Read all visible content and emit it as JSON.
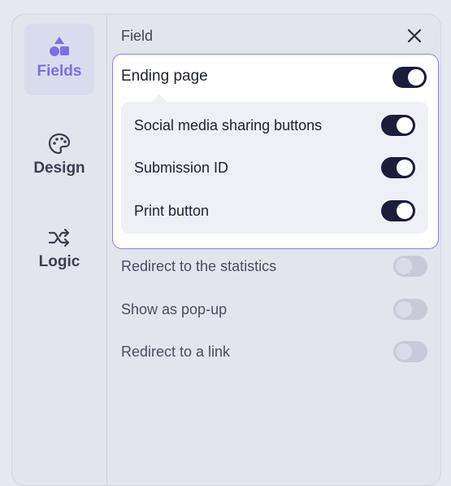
{
  "sidebar": {
    "items": [
      {
        "label": "Fields",
        "icon": "shapes-icon",
        "active": true
      },
      {
        "label": "Design",
        "icon": "palette-icon",
        "active": false
      },
      {
        "label": "Logic",
        "icon": "shuffle-icon",
        "active": false
      }
    ]
  },
  "header": {
    "title": "Field",
    "close_icon": "close-icon"
  },
  "ending_page": {
    "label": "Ending page",
    "enabled": true,
    "sub_options": [
      {
        "label": "Social media sharing buttons",
        "enabled": true
      },
      {
        "label": "Submission ID",
        "enabled": true
      },
      {
        "label": "Print button",
        "enabled": true
      }
    ]
  },
  "options": [
    {
      "label": "Redirect to the statistics",
      "enabled": false
    },
    {
      "label": "Show as pop-up",
      "enabled": false
    },
    {
      "label": "Redirect to a link",
      "enabled": false
    }
  ],
  "colors": {
    "accent": "#7d6ee6",
    "toggle_on": "#1b1d3a",
    "toggle_off": "#c7cbd8",
    "border_active": "#8c7ff0"
  }
}
